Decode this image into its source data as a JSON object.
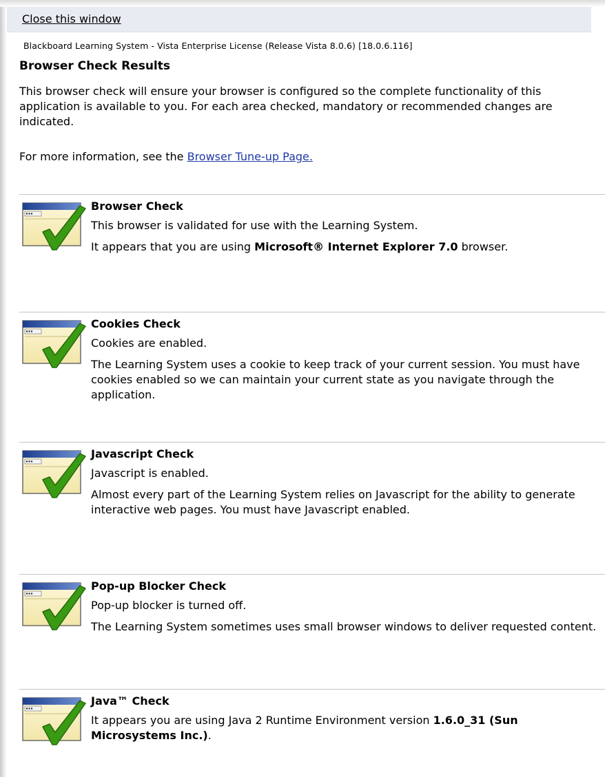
{
  "header": {
    "close_label": "Close this window",
    "product_line": "Blackboard Learning System - Vista Enterprise License (Release Vista 8.0.6) [18.0.6.116]",
    "title": "Browser Check Results"
  },
  "intro": {
    "text": "This browser check will ensure your browser is configured so the complete functionality of this application is available to you. For each area checked, mandatory or recommended changes are indicated.",
    "more_info_prefix": "For more information, see the ",
    "more_info_link": "Browser Tune-up Page."
  },
  "checks": [
    {
      "title": "Browser Check",
      "status": "This browser is validated for use with the Learning System.",
      "desc_prefix": "It appears that you are using ",
      "desc_bold": "Microsoft® Internet Explorer 7.0",
      "desc_suffix": " browser.",
      "icon": "window-checkmark-icon"
    },
    {
      "title": "Cookies Check",
      "status": "Cookies are enabled.",
      "desc": "The Learning System uses a cookie to keep track of your current session. You must have cookies enabled so we can maintain your current state as you navigate through the application.",
      "icon": "window-checkmark-icon"
    },
    {
      "title": "Javascript Check",
      "status": "Javascript is enabled.",
      "desc": "Almost every part of the Learning System relies on Javascript for the ability to generate interactive web pages. You must have Javascript enabled.",
      "icon": "window-checkmark-icon"
    },
    {
      "title": "Pop-up Blocker Check",
      "status": "Pop-up blocker is turned off.",
      "desc": "The Learning System sometimes uses small browser windows to deliver requested content.",
      "icon": "window-checkmark-icon"
    },
    {
      "title": "Java™ Check",
      "desc_prefix": "It appears you are using Java 2 Runtime Environment version ",
      "desc_bold": "1.6.0_31 (Sun Microsystems Inc.)",
      "desc_suffix": ".",
      "icon": "window-checkmark-icon"
    }
  ],
  "colors": {
    "close_bar": "#e8ebf2",
    "link": "#1f3aa8",
    "check_green": "#3a9a14",
    "divider": "#c4c4c4"
  }
}
